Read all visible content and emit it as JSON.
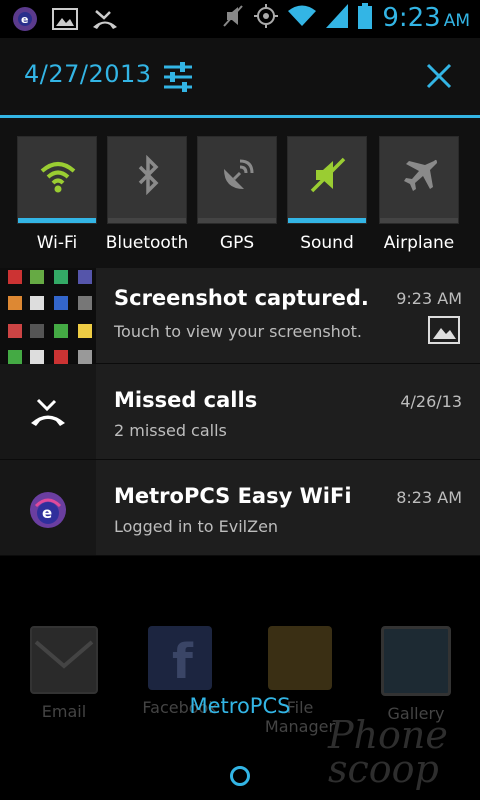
{
  "status_bar": {
    "time": "9:23",
    "ampm": "AM",
    "icons": [
      "metropcs-wifi-icon",
      "image-icon",
      "missed-call-icon",
      "mute-icon",
      "gps-icon",
      "wifi-icon",
      "signal-icon",
      "battery-icon"
    ]
  },
  "header": {
    "date": "4/27/2013",
    "accent": "#33b5e5"
  },
  "toggles": [
    {
      "label": "Wi-Fi",
      "state": "on",
      "icon": "wifi-icon"
    },
    {
      "label": "Bluetooth",
      "state": "off",
      "icon": "bluetooth-icon"
    },
    {
      "label": "GPS",
      "state": "off",
      "icon": "gps-icon"
    },
    {
      "label": "Sound",
      "state": "on",
      "icon": "sound-muted-icon"
    },
    {
      "label": "Airplane",
      "state": "off",
      "icon": "airplane-icon"
    }
  ],
  "notifications": [
    {
      "title": "Screenshot captured.",
      "subtitle": "Touch to view your screenshot.",
      "time": "9:23 AM",
      "icon": "screenshot-thumbnail"
    },
    {
      "title": "Missed calls",
      "subtitle": "2 missed calls",
      "time": "4/26/13",
      "icon": "missed-call-icon"
    },
    {
      "title": "MetroPCS Easy WiFi",
      "subtitle": "Logged in to EvilZen",
      "time": "8:23 AM",
      "icon": "metropcs-easy-wifi-icon"
    }
  ],
  "home_apps": [
    {
      "label": "Email",
      "icon": "email-icon"
    },
    {
      "label": "Facebook",
      "icon": "facebook-icon"
    },
    {
      "label": "File Manager",
      "icon": "folder-icon"
    },
    {
      "label": "Gallery",
      "icon": "gallery-icon"
    }
  ],
  "carrier": "MetroPCS",
  "watermark": "Phone scoop"
}
